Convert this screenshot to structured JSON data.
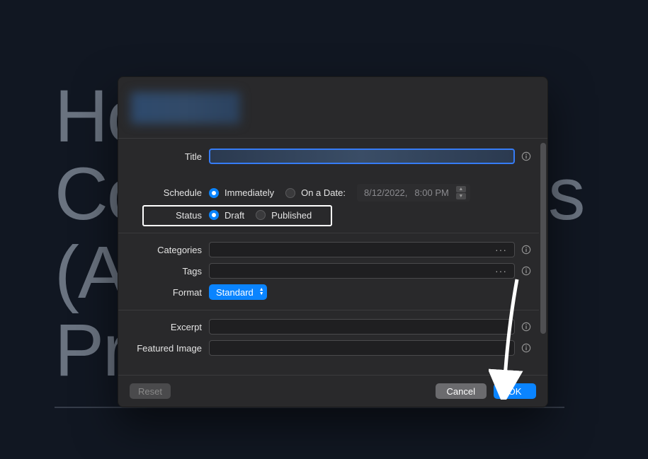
{
  "bg": {
    "line1": "Ho",
    "line2": "Co                   ss",
    "line3": "(A",
    "line4": "Pr"
  },
  "labels": {
    "title": "Title",
    "schedule": "Schedule",
    "status": "Status",
    "categories": "Categories",
    "tags": "Tags",
    "format": "Format",
    "excerpt": "Excerpt",
    "featured": "Featured Image"
  },
  "schedule": {
    "immediately": "Immediately",
    "on_a_date": "On a Date:",
    "date": "8/12/2022,",
    "time": "8:00 PM"
  },
  "status": {
    "draft": "Draft",
    "published": "Published"
  },
  "format": {
    "value": "Standard"
  },
  "buttons": {
    "reset": "Reset",
    "cancel": "Cancel",
    "ok": "OK"
  }
}
